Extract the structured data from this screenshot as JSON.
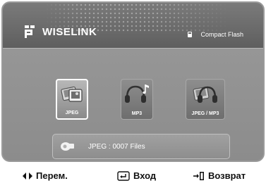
{
  "header": {
    "brand": "WISELINK",
    "device_label": "Compact Flash"
  },
  "tiles": [
    {
      "label": "JPEG",
      "selected": true
    },
    {
      "label": "MP3",
      "selected": false
    },
    {
      "label": "JPEG / MP3",
      "selected": false
    }
  ],
  "info": {
    "text": "JPEG : 0007 Files"
  },
  "footer": {
    "move_label": "Перем.",
    "enter_label": "Вход",
    "return_label": "Возврат"
  }
}
